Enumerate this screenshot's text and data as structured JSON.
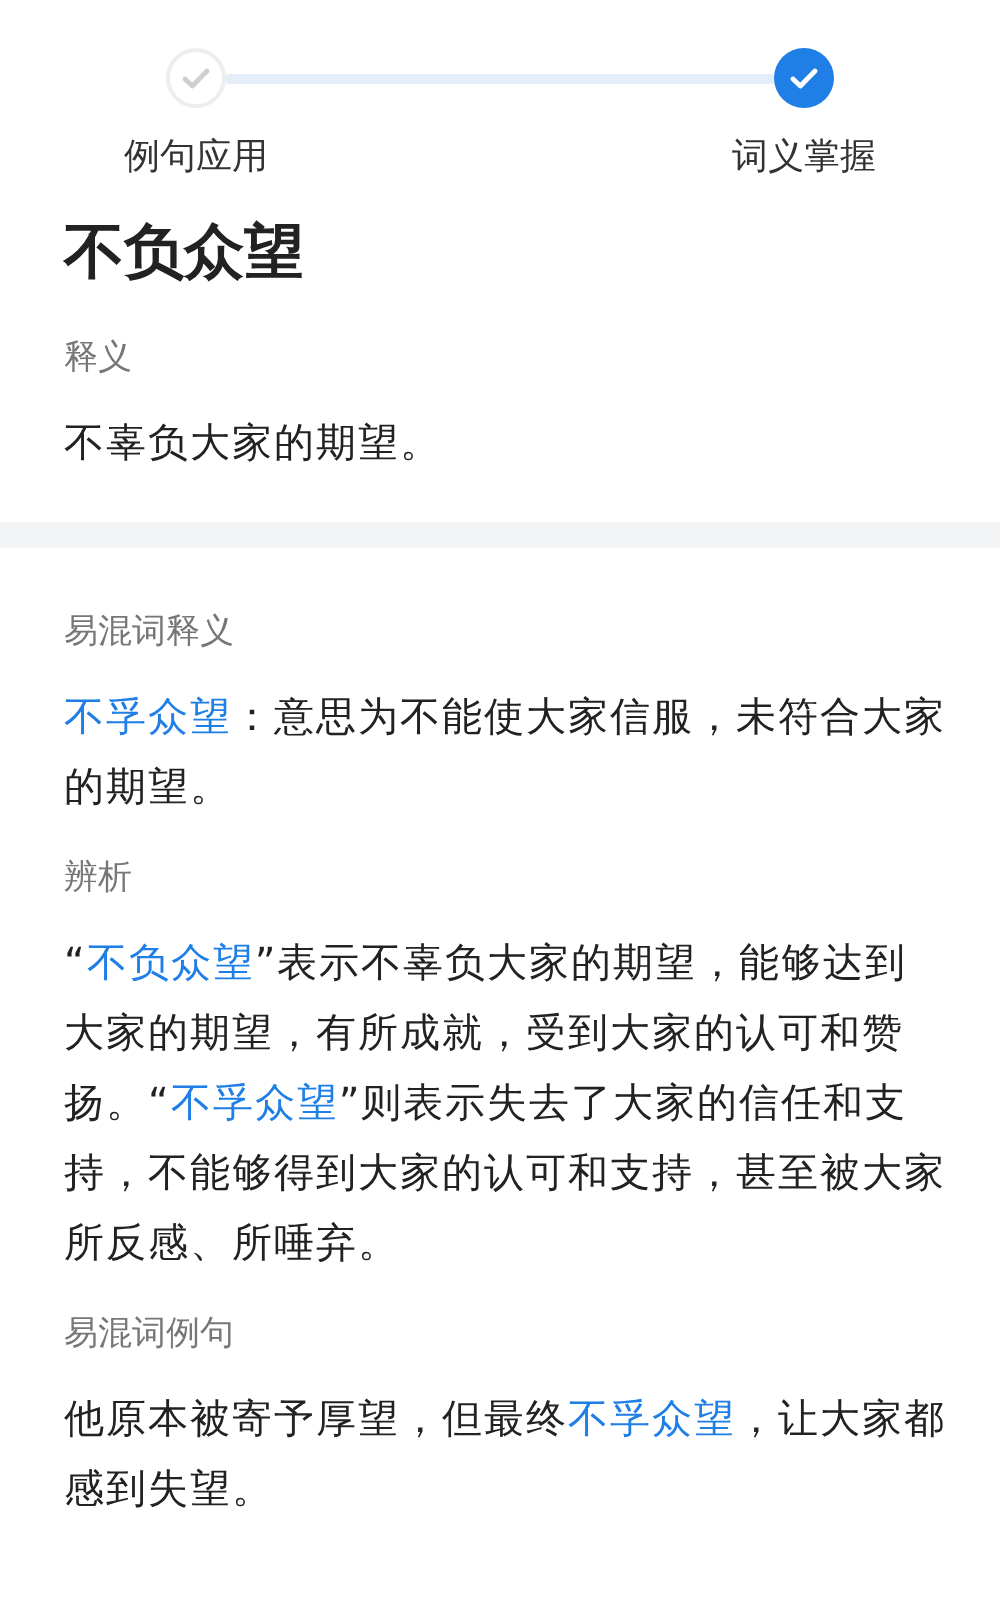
{
  "steps": [
    {
      "label": "例句应用",
      "selected": false
    },
    {
      "label": "词义掌握",
      "selected": true
    }
  ],
  "word": "不负众望",
  "definition": {
    "heading": "释义",
    "text": "不辜负大家的期望。"
  },
  "sections": [
    {
      "heading": "易混词释义",
      "segments": [
        {
          "kind": "link",
          "text": "不孚众望"
        },
        {
          "kind": "plain",
          "text": "：意思为不能使大家信服，未符合大家的期望。"
        }
      ]
    },
    {
      "heading": "辨析",
      "segments": [
        {
          "kind": "plain",
          "text": "“"
        },
        {
          "kind": "link",
          "text": "不负众望"
        },
        {
          "kind": "plain",
          "text": "”表示不辜负大家的期望，能够达到大家的期望，有所成就，受到大家的认可和赞扬。“"
        },
        {
          "kind": "link",
          "text": "不孚众望"
        },
        {
          "kind": "plain",
          "text": "”则表示失去了大家的信任和支持，不能够得到大家的认可和支持，甚至被大家所反感、所唾弃。"
        }
      ]
    },
    {
      "heading": "易混词例句",
      "segments": [
        {
          "kind": "plain",
          "text": "他原本被寄予厚望，但最终"
        },
        {
          "kind": "link",
          "text": "不孚众望"
        },
        {
          "kind": "plain",
          "text": "，让大家都感到失望。"
        }
      ]
    }
  ]
}
